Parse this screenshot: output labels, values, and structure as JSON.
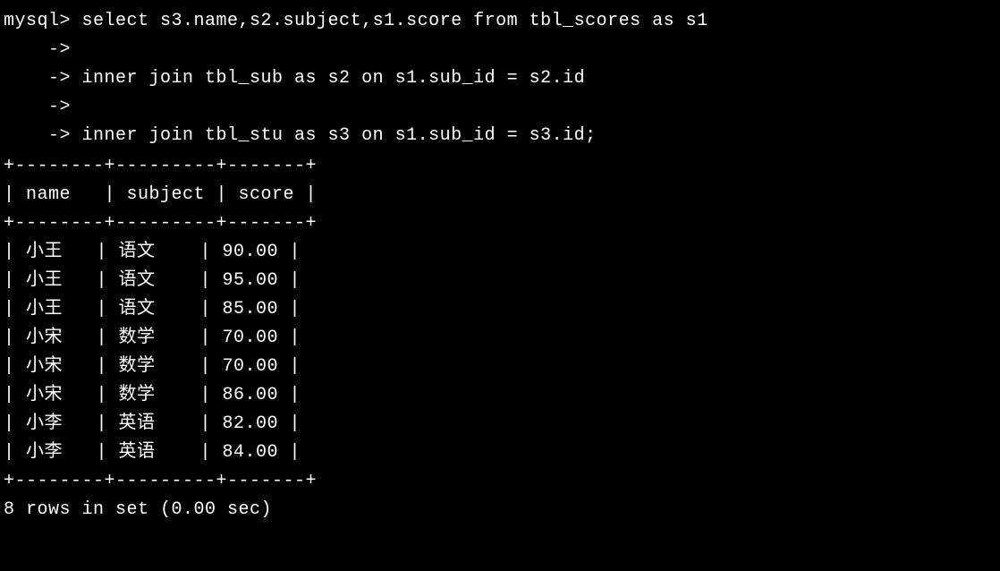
{
  "terminal": {
    "prompt": "mysql> ",
    "continuation": "    -> ",
    "query_lines": [
      "select s3.name,s2.subject,s1.score from tbl_scores as s1",
      "",
      "inner join tbl_sub as s2 on s1.sub_id = s2.id",
      "",
      "inner join tbl_stu as s3 on s1.sub_id = s3.id;"
    ],
    "table": {
      "border": "+--------+---------+-------+",
      "header": "| name   | subject | score |",
      "rows": [
        "| 小王   | 语文    | 90.00 |",
        "| 小王   | 语文    | 95.00 |",
        "| 小王   | 语文    | 85.00 |",
        "| 小宋   | 数学    | 70.00 |",
        "| 小宋   | 数学    | 70.00 |",
        "| 小宋   | 数学    | 86.00 |",
        "| 小李   | 英语    | 82.00 |",
        "| 小李   | 英语    | 84.00 |"
      ]
    },
    "footer": "8 rows in set (0.00 sec)"
  },
  "chart_data": {
    "type": "table",
    "title": "MySQL Query Result",
    "columns": [
      "name",
      "subject",
      "score"
    ],
    "rows": [
      {
        "name": "小王",
        "subject": "语文",
        "score": 90.0
      },
      {
        "name": "小王",
        "subject": "语文",
        "score": 95.0
      },
      {
        "name": "小王",
        "subject": "语文",
        "score": 85.0
      },
      {
        "name": "小宋",
        "subject": "数学",
        "score": 70.0
      },
      {
        "name": "小宋",
        "subject": "数学",
        "score": 70.0
      },
      {
        "name": "小宋",
        "subject": "数学",
        "score": 86.0
      },
      {
        "name": "小李",
        "subject": "英语",
        "score": 82.0
      },
      {
        "name": "小李",
        "subject": "英语",
        "score": 84.0
      }
    ],
    "row_count": 8,
    "execution_time_sec": 0.0
  }
}
